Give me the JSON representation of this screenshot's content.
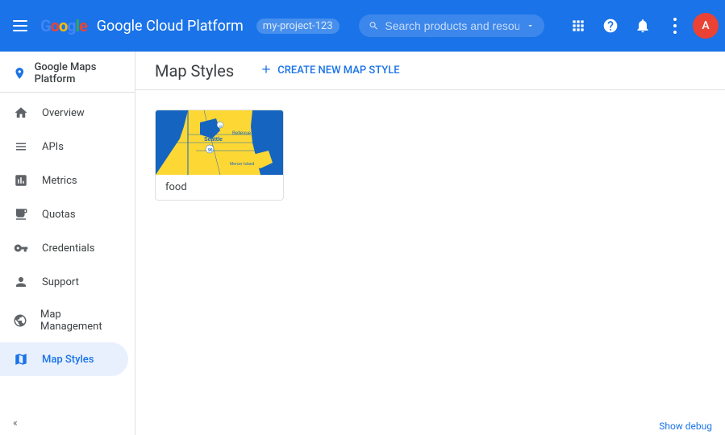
{
  "topbar": {
    "app_name": "Google Cloud Platform",
    "account_label": "my-project-123",
    "search_placeholder": "Search products and resources",
    "dropdown_label": "▾",
    "icons": {
      "menu": "☰",
      "apps": "⊞",
      "help": "?",
      "notifications": "🔔",
      "more": "⋮",
      "avatar": "A"
    }
  },
  "subheader": {
    "product_name": "Google Maps Platform"
  },
  "sidebar": {
    "items": [
      {
        "id": "overview",
        "label": "Overview",
        "icon": "home"
      },
      {
        "id": "apis",
        "label": "APIs",
        "icon": "grid"
      },
      {
        "id": "metrics",
        "label": "Metrics",
        "icon": "bar-chart"
      },
      {
        "id": "quotas",
        "label": "Quotas",
        "icon": "monitor"
      },
      {
        "id": "credentials",
        "label": "Credentials",
        "icon": "key"
      },
      {
        "id": "support",
        "label": "Support",
        "icon": "person"
      },
      {
        "id": "map-management",
        "label": "Map Management",
        "icon": "layers"
      },
      {
        "id": "map-styles",
        "label": "Map Styles",
        "icon": "map-pin",
        "active": true
      }
    ],
    "collapse_label": "«"
  },
  "page": {
    "title": "Map Styles",
    "create_button_label": "CREATE NEW MAP STYLE"
  },
  "map_cards": [
    {
      "id": "food",
      "label": "food",
      "thumbnail_colors": {
        "water": "#1565c0",
        "land": "#fdd835",
        "road": "#1565c0",
        "label": "#1565c0"
      }
    }
  ],
  "bottom_bar": {
    "debug_label": "Show debug"
  }
}
